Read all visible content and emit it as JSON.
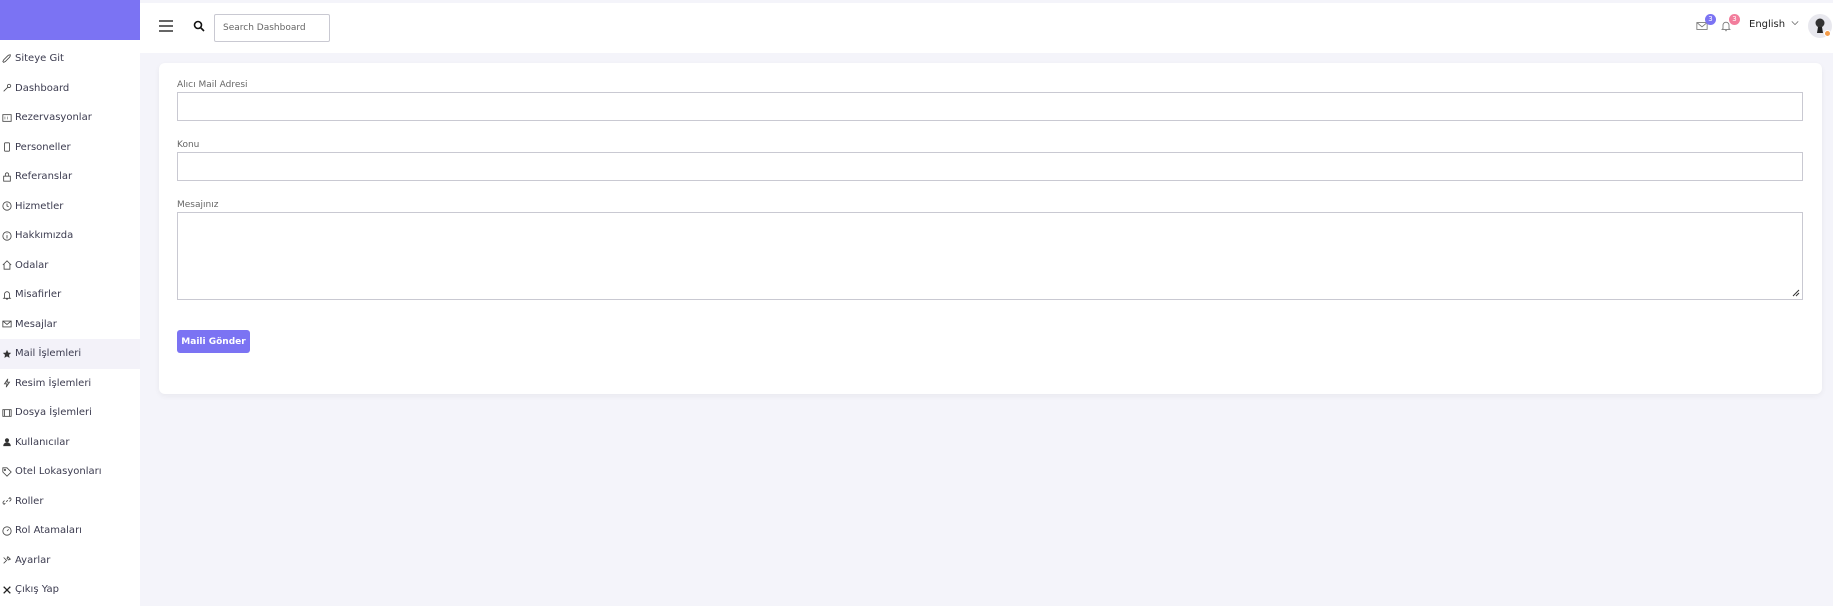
{
  "sidebar": {
    "items": [
      {
        "label": "Siteye Git",
        "icon": "rocket-icon"
      },
      {
        "label": "Dashboard",
        "icon": "tools-icon"
      },
      {
        "label": "Rezervasyonlar",
        "icon": "calendar-icon"
      },
      {
        "label": "Personeller",
        "icon": "phone-icon"
      },
      {
        "label": "Referanslar",
        "icon": "lock-icon"
      },
      {
        "label": "Hizmetler",
        "icon": "clock-icon"
      },
      {
        "label": "Hakkımızda",
        "icon": "info-icon"
      },
      {
        "label": "Odalar",
        "icon": "home-icon"
      },
      {
        "label": "Misafirler",
        "icon": "bell-icon"
      },
      {
        "label": "Mesajlar",
        "icon": "mail-icon"
      },
      {
        "label": "Mail İşlemleri",
        "icon": "star-icon"
      },
      {
        "label": "Resim İşlemleri",
        "icon": "bolt-icon"
      },
      {
        "label": "Dosya İşlemleri",
        "icon": "film-icon"
      },
      {
        "label": "Kullanıcılar",
        "icon": "user-icon"
      },
      {
        "label": "Otel Lokasyonları",
        "icon": "tag-icon"
      },
      {
        "label": "Roller",
        "icon": "link-icon"
      },
      {
        "label": "Rol Atamaları",
        "icon": "gauge-icon"
      },
      {
        "label": "Ayarlar",
        "icon": "wrench-icon"
      },
      {
        "label": "Çıkış Yap",
        "icon": "close-icon"
      }
    ],
    "active_index": 10
  },
  "topbar": {
    "search_placeholder": "Search Dashboard",
    "mail_badge": "3",
    "notif_badge": "3",
    "language": "English"
  },
  "form": {
    "recipient_label": "Alıcı Mail Adresi",
    "subject_label": "Konu",
    "message_label": "Mesajınız",
    "recipient_value": "",
    "subject_value": "",
    "message_value": "",
    "submit_label": "Maili Gönder"
  },
  "colors": {
    "accent": "#7b73f3",
    "mail_badge": "#7b73f3",
    "notif_badge": "#f27d9c",
    "background": "#f4f4fa"
  }
}
